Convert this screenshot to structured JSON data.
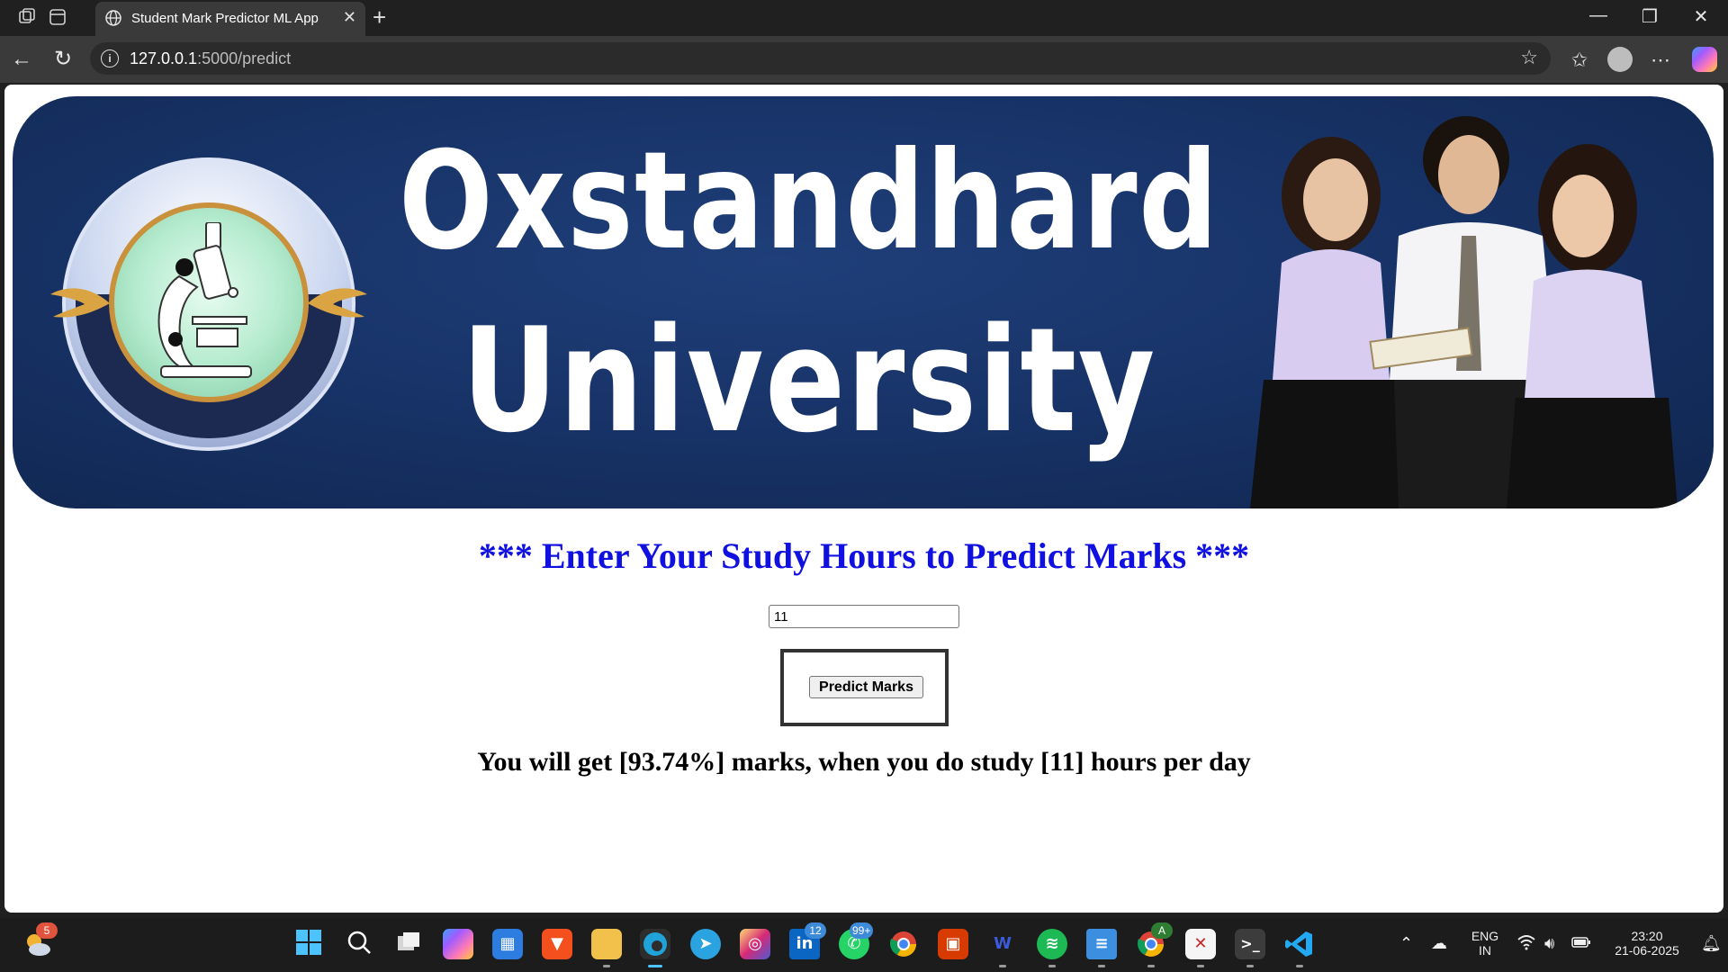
{
  "browser": {
    "tab_title": "Student Mark Predictor ML App",
    "url_host": "127.0.0.1",
    "url_path": ":5000/predict",
    "new_tab_symbol": "+",
    "tab_close_symbol": "✕"
  },
  "banner": {
    "line1": "Oxstandhard",
    "line2": "University"
  },
  "form": {
    "heading": "*** Enter Your Study Hours to Predict Marks ***",
    "hours_value": "11",
    "button_label": "Predict Marks"
  },
  "result": {
    "text": "You will get [93.74%] marks, when you do study [11] hours per day"
  },
  "taskbar": {
    "weather_badge": "5",
    "linkedin_badge": "12",
    "whatsapp_badge": "99+",
    "chrome_badge": "A",
    "lang_line1": "ENG",
    "lang_line2": "IN",
    "time": "23:20",
    "date": "21-06-2025"
  },
  "colors": {
    "banner_bg": "#173266",
    "heading": "#1010e0",
    "taskbar_bg": "#1c1c1c"
  }
}
